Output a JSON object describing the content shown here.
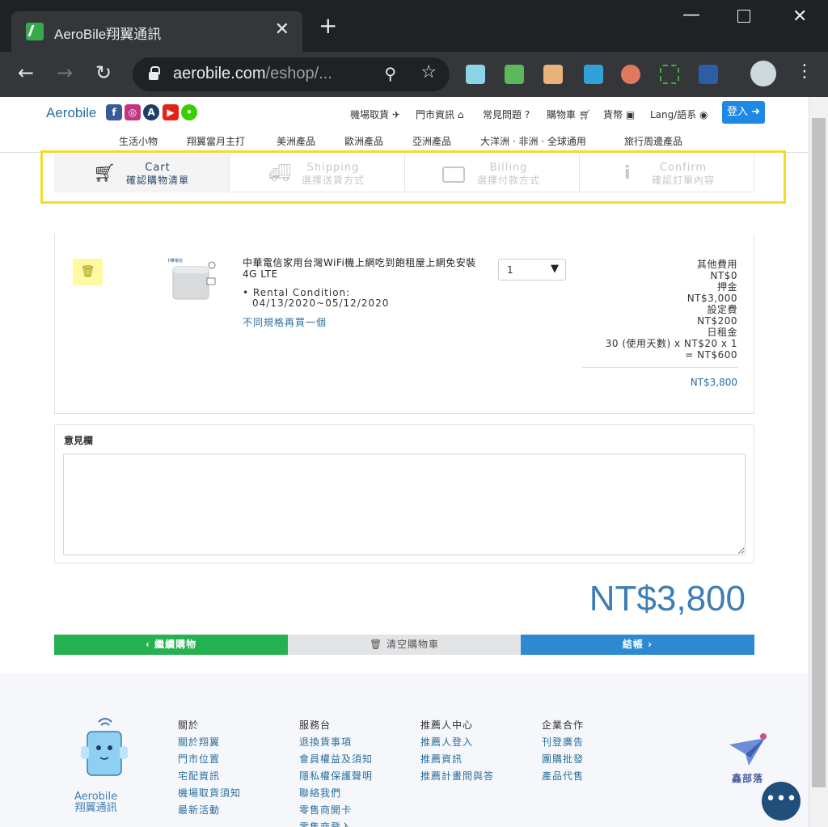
{
  "browser": {
    "tab_title": "AeroBile翔翼通訊",
    "tab_close": "✕",
    "new_tab": "+",
    "url_host": "aerobile.com",
    "url_path": "/eshop/..."
  },
  "header": {
    "logo": "Aerobile",
    "nav": {
      "airport": "機場取貨",
      "store": "門市資訊",
      "faq": "常見問題",
      "cart": "購物車",
      "currency": "貨幣",
      "lang": "Lang/語系"
    },
    "login": "登入",
    "categories": [
      "生活小物",
      "翔翼當月主打",
      "美洲產品",
      "歐洲產品",
      "亞洲產品",
      "大洋洲 · 非洲 · 全球通用",
      "旅行周邊產品"
    ]
  },
  "steps": [
    {
      "en": "Cart",
      "zh": "確認購物清單",
      "icon": "cart-icon"
    },
    {
      "en": "Shipping",
      "zh": "選擇送貨方式",
      "icon": "truck-icon"
    },
    {
      "en": "Billing",
      "zh": "選擇付款方式",
      "icon": "credit-card-icon"
    },
    {
      "en": "Confirm",
      "zh": "確認訂單內容",
      "icon": "info-icon"
    }
  ],
  "cart": {
    "product_name": "中華電信家用台灣WiFi機上網吃到飽租屋上網免安裝 4G LTE",
    "rental_label": "Rental Condition:",
    "rental_dates": "04/13/2020~05/12/2020",
    "another_spec": "不同規格再買一個",
    "quantity": "1",
    "fees": {
      "other_label": "其他費用",
      "other_value": "NT$0",
      "deposit_label": "押金",
      "deposit_value": "NT$3,000",
      "setup_label": "設定費",
      "setup_value": "NT$200",
      "daily_label": "日租金",
      "daily_calc": "30 (使用天數) x NT$20 x 1",
      "daily_value": "= NT$600"
    },
    "subtotal": "NT$3,800"
  },
  "comments": {
    "label": "意見欄",
    "value": ""
  },
  "total": "NT$3,800",
  "buttons": {
    "continue": "繼續購物",
    "clear": "清空購物車",
    "checkout": "結帳"
  },
  "footer": {
    "mascot_label1": "Aerobile",
    "mascot_label2": "翔翼通訊",
    "cols": [
      {
        "heading": "關於",
        "items": [
          "關於翔翼",
          "門市位置",
          "宅配資訊",
          "機場取貨須知",
          "最新活動"
        ]
      },
      {
        "heading": "服務台",
        "items": [
          "退換貨事項",
          "會員權益及須知",
          "隱私權保護聲明",
          "聯絡我們",
          "零售商開卡",
          "零售商登入"
        ]
      },
      {
        "heading": "推薦人中心",
        "items": [
          "推薦人登入",
          "推薦資訊",
          "推薦計畫問與答"
        ]
      },
      {
        "heading": "企業合作",
        "items": [
          "刊登廣告",
          "團購批發",
          "產品代售"
        ]
      }
    ],
    "brand2": "鑫部落"
  },
  "colors": {
    "accent": "#1e88e5",
    "highlight": "#f1dc2a",
    "green": "#24b14f",
    "blue": "#2d8ad2"
  }
}
